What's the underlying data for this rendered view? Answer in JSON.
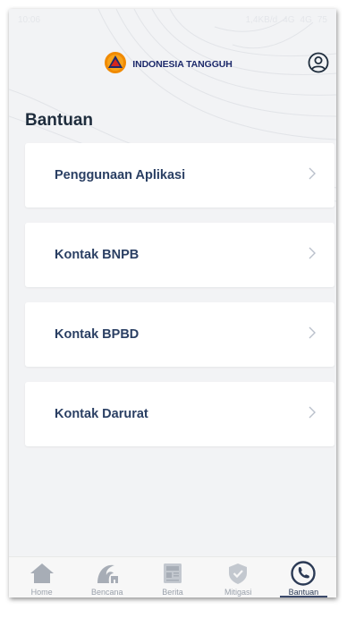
{
  "status_bar": {
    "time": "10:06",
    "network": "1,4KB/d",
    "signal_1": "4G",
    "signal_2": "4G",
    "battery": "75"
  },
  "header": {
    "brand_name": "INDONESIA TANGGUH",
    "logo_icon": "bnpb-logo-icon",
    "profile_icon": "user-circle-icon"
  },
  "page": {
    "title": "Bantuan"
  },
  "menu": {
    "items": [
      {
        "label": "Penggunaan Aplikasi"
      },
      {
        "label": "Kontak BNPB"
      },
      {
        "label": "Kontak BPBD"
      },
      {
        "label": "Kontak Darurat"
      }
    ]
  },
  "bottom_nav": {
    "active": "Bantuan",
    "items": [
      {
        "label": "Home",
        "icon": "home-icon"
      },
      {
        "label": "Bencana",
        "icon": "tsunami-icon"
      },
      {
        "label": "Berita",
        "icon": "news-icon"
      },
      {
        "label": "Mitigasi",
        "icon": "shield-check-icon"
      },
      {
        "label": "Bantuan",
        "icon": "phone-call-icon"
      }
    ]
  },
  "colors": {
    "brand_navy": "#1d2a6b",
    "logo_orange": "#f08a00",
    "logo_red": "#d7261e",
    "card_text": "#2a3f63",
    "nav_inactive": "#9aa1ab",
    "nav_active": "#2b3a55"
  }
}
